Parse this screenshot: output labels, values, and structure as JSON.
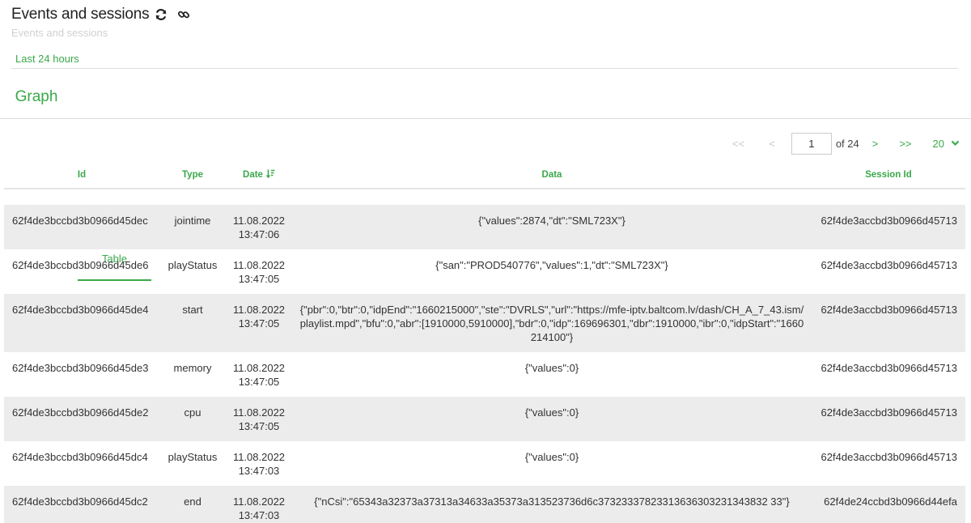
{
  "header": {
    "title": "Events and sessions",
    "subtitle": "Events and sessions"
  },
  "time_range": {
    "label": "Last 24 hours"
  },
  "tabs": [
    {
      "label": "Graph",
      "active": false
    },
    {
      "label": "Table",
      "active": true
    }
  ],
  "pagination": {
    "first": "<<",
    "prev": "<",
    "current_page": "1",
    "of_label": "of 24",
    "next": ">",
    "last": ">>",
    "page_size": "20"
  },
  "table": {
    "columns": [
      "Id",
      "Type",
      "Date",
      "Data",
      "Session Id"
    ],
    "rows": [
      {
        "id": "62f4de3bccbd3b0966d45dec",
        "type": "jointime",
        "date": "11.08.2022",
        "time": "13:47:06",
        "data": "{\"values\":2874,\"dt\":\"SML723X\"}",
        "session": "62f4de3accbd3b0966d45713"
      },
      {
        "id": "62f4de3bccbd3b0966d45de6",
        "type": "playStatus",
        "date": "11.08.2022",
        "time": "13:47:05",
        "data": "{\"san\":\"PROD540776\",\"values\":1,\"dt\":\"SML723X\"}",
        "session": "62f4de3accbd3b0966d45713"
      },
      {
        "id": "62f4de3bccbd3b0966d45de4",
        "type": "start",
        "date": "11.08.2022",
        "time": "13:47:05",
        "data": "{\"pbr\":0,\"btr\":0,\"idpEnd\":\"1660215000\",\"ste\":\"DVRLS\",\"url\":\"https://mfe-iptv.baltcom.lv/dash/CH_A_7_43.ism/playlist.mpd\",\"bfu\":0,\"abr\":[1910000,5910000],\"bdr\":0,\"idp\":169696301,\"dbr\":1910000,\"ibr\":0,\"idpStart\":\"1660214100\"}",
        "session": "62f4de3accbd3b0966d45713"
      },
      {
        "id": "62f4de3bccbd3b0966d45de3",
        "type": "memory",
        "date": "11.08.2022",
        "time": "13:47:05",
        "data": "{\"values\":0}",
        "session": "62f4de3accbd3b0966d45713"
      },
      {
        "id": "62f4de3bccbd3b0966d45de2",
        "type": "cpu",
        "date": "11.08.2022",
        "time": "13:47:05",
        "data": "{\"values\":0}",
        "session": "62f4de3accbd3b0966d45713"
      },
      {
        "id": "62f4de3bccbd3b0966d45dc4",
        "type": "playStatus",
        "date": "11.08.2022",
        "time": "13:47:03",
        "data": "{\"values\":0}",
        "session": "62f4de3accbd3b0966d45713"
      },
      {
        "id": "62f4de3bccbd3b0966d45dc2",
        "type": "end",
        "date": "11.08.2022",
        "time": "13:47:03",
        "data": "{\"nCsi\":\"65343a32373a37313a34633a35373a313523736d6c37323337823313636303231343832 33\"}",
        "session": "62f4de24ccbd3b0966d44efa"
      }
    ]
  },
  "icons": {
    "refresh": "refresh-icon",
    "link": "link-icon",
    "sort": "sort-descending-icon",
    "chevron": "chevron-down-icon"
  },
  "colors": {
    "accent": "#3aa84a",
    "row_stripe": "#ececec",
    "title": "#222222"
  }
}
